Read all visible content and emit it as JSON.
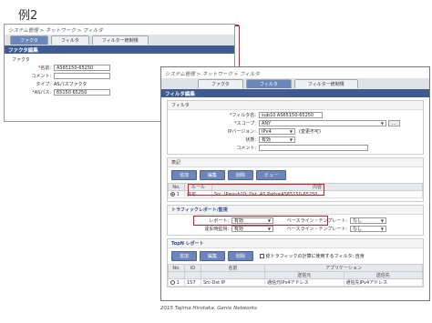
{
  "slide_title": "例2",
  "back_window": {
    "breadcrumb": "システム管理 > ネットワーク > フィルタ",
    "tabs": [
      "ファクタ",
      "フィルタ",
      "フィルター統制規"
    ],
    "panel_title": "ファクタ編集",
    "group_legend": "ファクタ",
    "fields": [
      {
        "label": "名前:",
        "required": true,
        "value": "AS65150-65250",
        "kind": "input"
      },
      {
        "label": "コメント:",
        "required": false,
        "value": "",
        "kind": "input"
      },
      {
        "label": "タイプ:",
        "required": false,
        "value": "ASパスファクタ",
        "kind": "text"
      },
      {
        "label": "ASパス:",
        "required": true,
        "value": "65150 65250",
        "kind": "input"
      }
    ]
  },
  "front_window": {
    "breadcrumb": "システム管理 > ネットワーク > フィルタ",
    "tabs": [
      "ファクタ",
      "フィルタ",
      "フィルター統制規"
    ],
    "panel_title": "フィルタ編集",
    "filter_section": {
      "title": "フィルタ",
      "fields": [
        {
          "label": "フィルタ名:",
          "required": true,
          "value": "sub10 AS65150-65250",
          "kind": "input"
        },
        {
          "label": "スコープ:",
          "required": true,
          "value": "ANY",
          "kind": "select",
          "extra": "..."
        },
        {
          "label": "IPバージョン:",
          "required": false,
          "value": "IPv4",
          "kind": "select",
          "note": "(変更不可)"
        },
        {
          "label": "状態:",
          "required": false,
          "value": "有効",
          "kind": "select"
        },
        {
          "label": "コメント:",
          "required": false,
          "value": "",
          "kind": "input"
        }
      ]
    },
    "expression_section": {
      "title": "表記",
      "buttons": [
        "追加",
        "編集",
        "削除",
        "ビュー"
      ],
      "columns": [
        "No.",
        "ルール",
        "内容"
      ],
      "rows": [
        {
          "no": "1",
          "rule": "許可",
          "content": "Src. IP=sub10; Dst. AS Path=AS65150-65250"
        }
      ]
    },
    "traffic_section": {
      "title": "トラフィックレポート/監視",
      "rows": [
        {
          "label": "レポート:",
          "value": "有効",
          "right_label": "ベースライン・テンプレート:",
          "right_value": "なし"
        },
        {
          "label": "違反時監視:",
          "value": "有効",
          "right_label": "ベースライン・テンプレート:",
          "right_value": "なし"
        }
      ]
    },
    "topn_section": {
      "title": "TopN レポート",
      "buttons": [
        "追加",
        "編集",
        "削除"
      ],
      "checkbox_label": "総トラフィックの計算に使用するフィルタ: 自身",
      "columns": [
        "No.",
        "ID",
        "名前",
        "アプリケーション"
      ],
      "sub_columns": [
        "",
        "",
        "",
        "送信元",
        "送信先"
      ],
      "rows": [
        {
          "no": "1",
          "id": "157",
          "name": "Src-Dst IP",
          "src": "通信元IPv4アドレス",
          "dst": "通信先IPv4アドレス"
        }
      ]
    }
  },
  "copyright": "2015 Tajima Hirotaka, Genie Networks",
  "colors": {
    "accent": "#3f5b8f",
    "highlight": "#e0141e",
    "tab_active": "#6b86b8"
  }
}
